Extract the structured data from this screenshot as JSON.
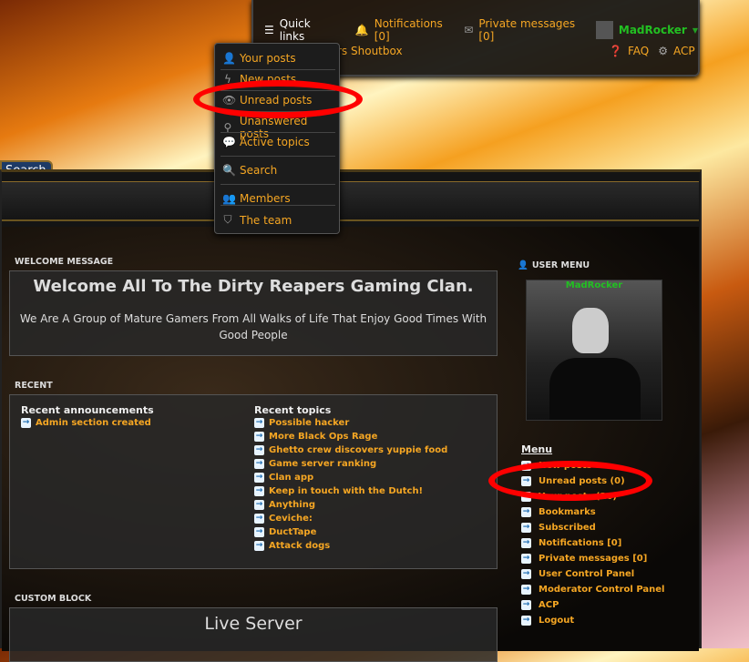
{
  "topbar": {
    "quick_links": "Quick links",
    "notifications": "Notifications [0]",
    "private_messages": "Private messages [0]",
    "username": "MadRocker",
    "shoutbox": "rs Shoutbox",
    "faq": "FAQ",
    "acp": "ACP"
  },
  "quick_links_menu": [
    "Your posts",
    "New posts",
    "Unread posts",
    "Unanswered posts",
    "Active topics",
    "Search",
    "Members",
    "The team"
  ],
  "search_tab": "Search",
  "welcome": {
    "heading": "WELCOME MESSAGE",
    "title": "Welcome All To The Dirty Reapers Gaming Clan.",
    "text": "We Are A Group of Mature Gamers From All Walks of Life That Enjoy Good Times With Good People"
  },
  "recent": {
    "heading": "RECENT",
    "announcements_title": "Recent announcements",
    "announcements": [
      "Admin section created"
    ],
    "topics_title": "Recent topics",
    "topics": [
      "Possible hacker",
      "More Black Ops Rage",
      "Ghetto crew discovers yuppie food",
      "Game server ranking",
      "Clan app",
      "Keep in touch with the Dutch!",
      "Anything",
      "Ceviche:",
      "DuctTape",
      "Attack dogs"
    ]
  },
  "custom": {
    "heading": "CUSTOM BLOCK",
    "title": "Live Server"
  },
  "user_menu": {
    "heading": "USER MENU",
    "username": "MadRocker",
    "menu_title": "Menu",
    "items": [
      "New posts",
      "Unread posts (0)",
      "Your posts (26)",
      "Bookmarks",
      "Subscribed",
      "Notifications [0]",
      "Private messages [0]",
      "User Control Panel",
      "Moderator Control Panel",
      "ACP",
      "Logout"
    ]
  },
  "colors": {
    "link": "#f5a623",
    "username": "#22c022",
    "highlight": "#ff0000"
  }
}
